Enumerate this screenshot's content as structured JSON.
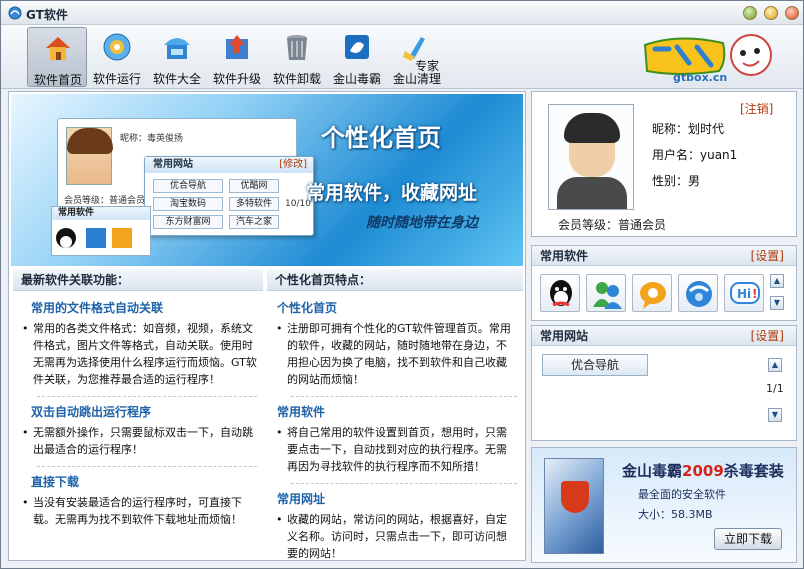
{
  "window": {
    "title": "GT软件"
  },
  "toolbar": {
    "items": [
      {
        "label": "软件首页",
        "icon": "home-icon"
      },
      {
        "label": "软件运行",
        "icon": "run-icon"
      },
      {
        "label": "软件大全",
        "icon": "collection-icon"
      },
      {
        "label": "软件升级",
        "icon": "upgrade-icon"
      },
      {
        "label": "软件卸载",
        "icon": "trash-icon"
      },
      {
        "label": "金山毒霸",
        "icon": "antivirus-icon"
      },
      {
        "label": "金山清理",
        "icon": "cleaner-icon"
      }
    ],
    "expert": "专家",
    "logo_domain": "gtbox.cn"
  },
  "banner": {
    "title": "个性化首页",
    "slogan": "常用软件，收藏网址",
    "sub": "随时随地带在身边",
    "mock_nick": "昵称：毒英俊扬",
    "mock_level": "会员等级：普通会员",
    "mock_sites_head": "常用网站",
    "mock_edit": "[修改]",
    "mock_soft_head": "常用软件",
    "mock_cells": [
      "优合导航",
      "淘宝数码",
      "东方财富网",
      "优酷网",
      "多特软件",
      "汽车之家"
    ],
    "mock_page": "10/10"
  },
  "left": {
    "header": "最新软件关联功能：",
    "sections": [
      {
        "title": "常用的文件格式自动关联",
        "body": "常用的各类文件格式：如音频，视频，系统文件格式，图片文件等格式，自动关联。使用时无需再为选择使用什么程序运行而烦恼。GT软件关联，为您推荐最合适的运行程序！"
      },
      {
        "title": "双击自动跳出运行程序",
        "body": "无需额外操作，只需要鼠标双击一下，自动跳出最适合的运行程序！"
      },
      {
        "title": "直接下载",
        "body": "当没有安装最适合的运行程序时，可直接下载。无需再为找不到软件下载地址而烦恼！"
      }
    ]
  },
  "middle": {
    "header": "个性化首页特点：",
    "sections": [
      {
        "title": "个性化首页",
        "body": "注册即可拥有个性化的GT软件管理首页。常用的软件，收藏的网站，随时随地带在身边，不用担心因为换了电脑，找不到软件和自己收藏的网站而烦恼！"
      },
      {
        "title": "常用软件",
        "body": "将自己常用的软件设置到首页，想用时，只需要点击一下，自动找到对应的执行程序。无需再因为寻找软件的执行程序而不知所措！"
      },
      {
        "title": "常用网址",
        "body": "收藏的网站，常访问的网站，根据喜好，自定义名称。访问时，只需点击一下，即可访问想要的网站！"
      }
    ]
  },
  "profile": {
    "logout": "[注销]",
    "nick": "昵称：划时代",
    "user": "用户名：yuan1",
    "gender": "性别：男",
    "level": "会员等级：普通会员"
  },
  "soft": {
    "header": "常用软件",
    "settings": "[设置]",
    "icons": [
      "qq-icon",
      "msn-icon",
      "chat-bubble-icon",
      "browser-icon",
      "hi-icon"
    ]
  },
  "sites": {
    "header": "常用网站",
    "settings": "[设置]",
    "item": "优合导航",
    "page": "1/1"
  },
  "ad": {
    "title_a": "金山毒霸",
    "title_b": "2009",
    "title_c": "杀毒套装",
    "desc": "最全面的安全软件",
    "size": "大小：58.3MB",
    "button": "立即下载"
  },
  "colors": {
    "accent": "#1f62a8",
    "link": "#b23a0a",
    "banner": "#1e8bd3"
  }
}
